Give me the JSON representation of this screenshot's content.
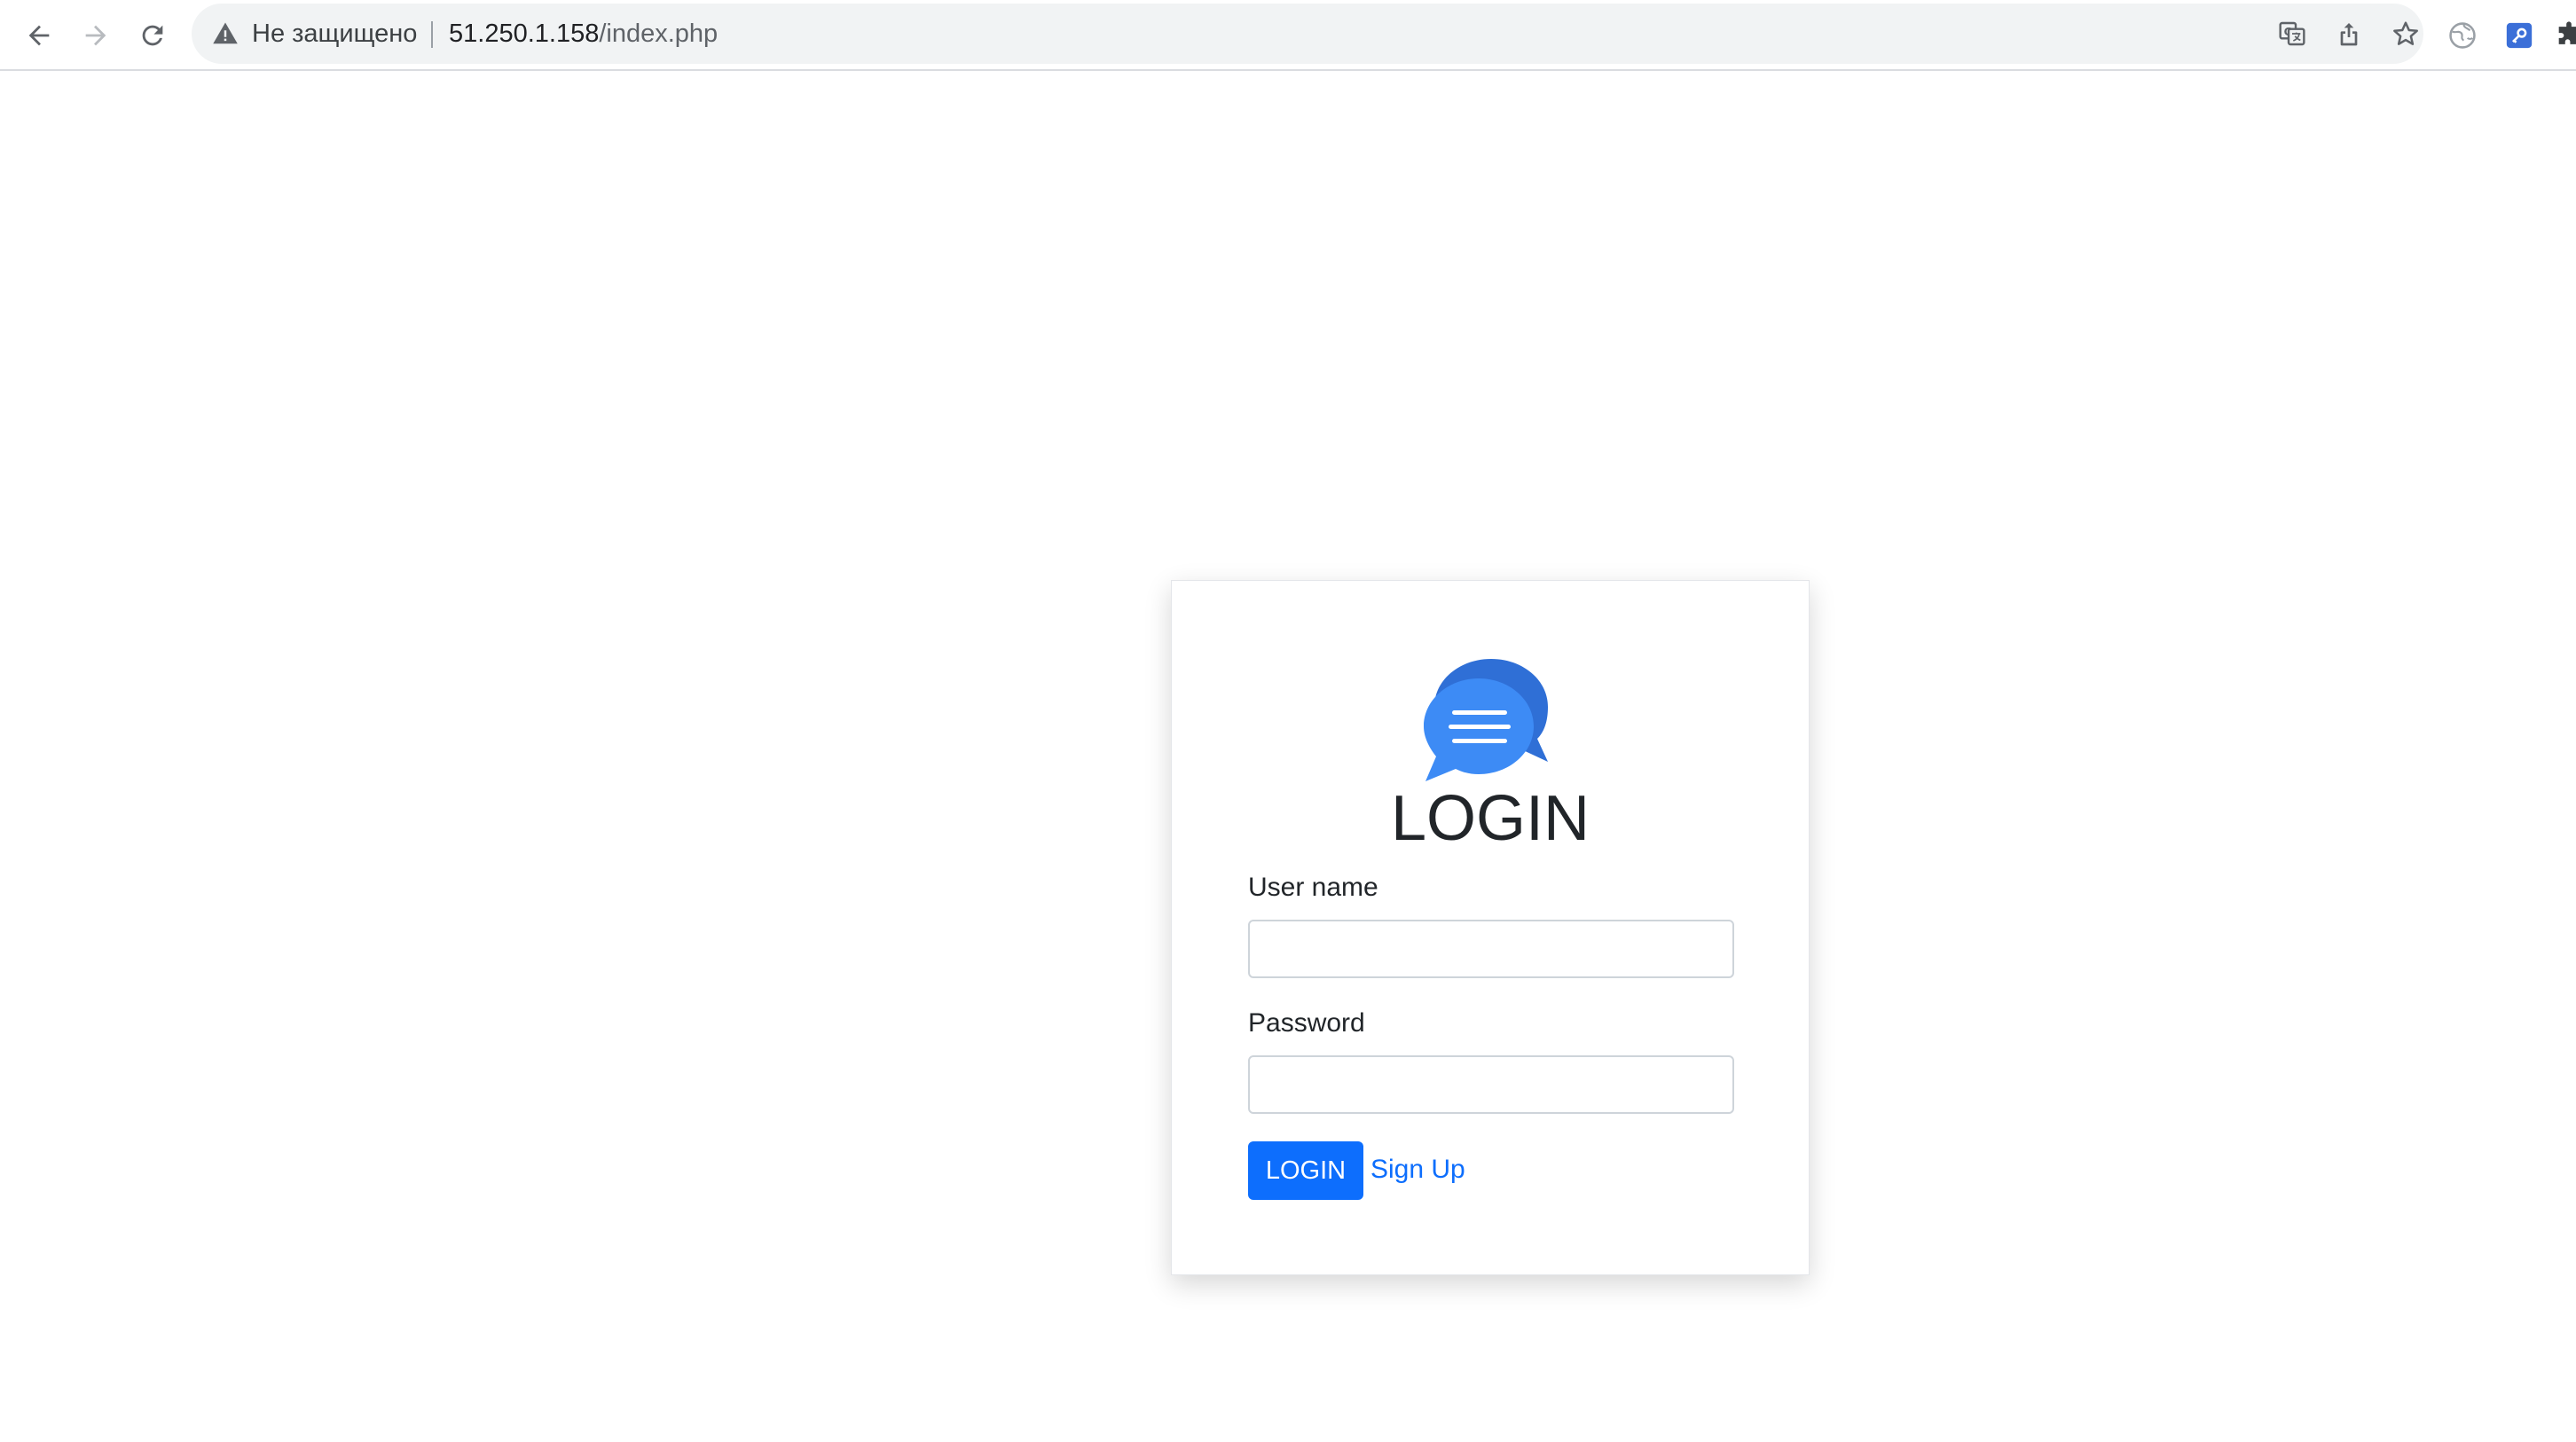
{
  "browser": {
    "security_label": "Не защищено",
    "url_host": "51.250.1.158",
    "url_path": "/index.php"
  },
  "login_form": {
    "title": "LOGIN",
    "username_label": "User name",
    "username_value": "",
    "password_label": "Password",
    "password_value": "",
    "submit_label": "LOGIN",
    "signup_label": "Sign Up"
  },
  "colors": {
    "primary": "#0d6efd",
    "logo_front": "#3d8bf5",
    "logo_back": "#2f6fd6"
  },
  "icons": {
    "back": "back-arrow-icon",
    "forward": "forward-arrow-icon",
    "reload": "reload-icon",
    "warning": "warning-triangle-icon",
    "translate": "translate-icon",
    "share": "share-icon",
    "bookmark": "star-icon",
    "extension1": "globe-extension-icon",
    "extension2": "key-extension-icon",
    "extensions": "puzzle-icon",
    "logo": "chat-bubbles-icon"
  }
}
